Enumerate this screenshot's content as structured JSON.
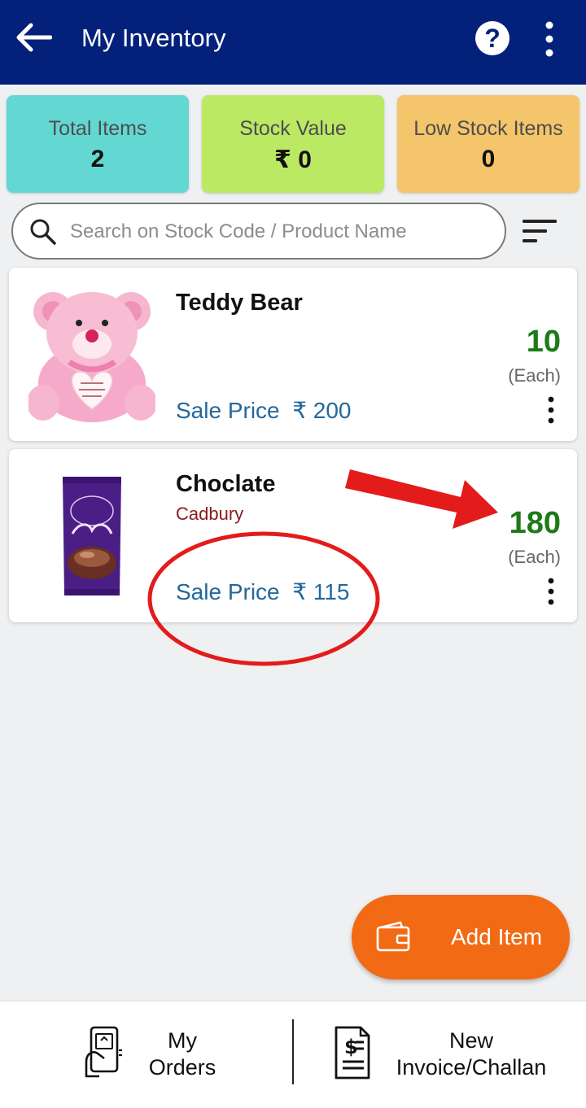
{
  "appbar": {
    "title": "My Inventory",
    "help_label": "?"
  },
  "stats": {
    "total_items": {
      "label": "Total Items",
      "value": "2"
    },
    "stock_value": {
      "label": "Stock Value",
      "value": "₹ 0"
    },
    "low_stock": {
      "label": "Low Stock Items",
      "value": "0"
    }
  },
  "colors": {
    "appbar": "#03217a",
    "total_items": "#63d8d2",
    "stock_value": "#bce964",
    "low_stock": "#f4c56a",
    "fab": "#f26a14",
    "qty": "#1e7a18",
    "price": "#23689b",
    "annotation": "#e41b1b"
  },
  "search": {
    "placeholder": "Search on Stock Code / Product Name"
  },
  "items": [
    {
      "name": "Teddy Bear",
      "brand": "",
      "sale_price_label": "Sale Price",
      "sale_price": "₹ 200",
      "quantity": "10",
      "unit": "(Each)",
      "image": "pink-teddy-bear"
    },
    {
      "name": "Choclate",
      "brand": "Cadbury",
      "sale_price_label": "Sale Price",
      "sale_price": "₹ 115",
      "quantity": "180",
      "unit": "(Each)",
      "image": "dairy-milk-silk-bar"
    }
  ],
  "fab": {
    "label": "Add Item",
    "icon": "wallet-icon"
  },
  "bottom_nav": [
    {
      "line1": "My",
      "line2": "Orders",
      "icon": "mobile-order-icon"
    },
    {
      "line1": "New",
      "line2": "Invoice/Challan",
      "icon": "invoice-dollar-icon"
    }
  ]
}
